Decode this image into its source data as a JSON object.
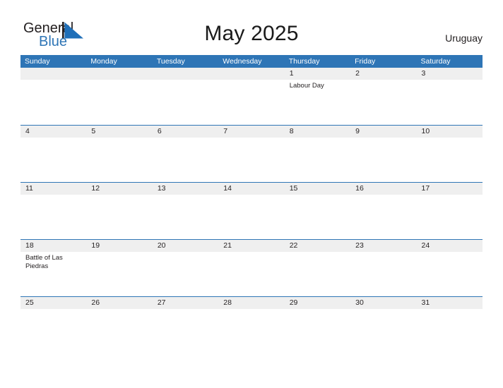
{
  "brand": {
    "word_one": "General",
    "word_two": "Blue",
    "mark_icon": "triangle-logo-icon",
    "accent_color": "#2e75b6",
    "text_color": "#231f20"
  },
  "header": {
    "title": "May 2025",
    "country": "Uruguay"
  },
  "calendar": {
    "header_bg": "#2e75b6",
    "band_bg": "#efefef",
    "row_border": "#2e75b6",
    "weekdays": [
      "Sunday",
      "Monday",
      "Tuesday",
      "Wednesday",
      "Thursday",
      "Friday",
      "Saturday"
    ],
    "weeks": [
      [
        {
          "day": "",
          "events": []
        },
        {
          "day": "",
          "events": []
        },
        {
          "day": "",
          "events": []
        },
        {
          "day": "",
          "events": []
        },
        {
          "day": "1",
          "events": [
            "Labour Day"
          ]
        },
        {
          "day": "2",
          "events": []
        },
        {
          "day": "3",
          "events": []
        }
      ],
      [
        {
          "day": "4",
          "events": []
        },
        {
          "day": "5",
          "events": []
        },
        {
          "day": "6",
          "events": []
        },
        {
          "day": "7",
          "events": []
        },
        {
          "day": "8",
          "events": []
        },
        {
          "day": "9",
          "events": []
        },
        {
          "day": "10",
          "events": []
        }
      ],
      [
        {
          "day": "11",
          "events": []
        },
        {
          "day": "12",
          "events": []
        },
        {
          "day": "13",
          "events": []
        },
        {
          "day": "14",
          "events": []
        },
        {
          "day": "15",
          "events": []
        },
        {
          "day": "16",
          "events": []
        },
        {
          "day": "17",
          "events": []
        }
      ],
      [
        {
          "day": "18",
          "events": [
            "Battle of Las Piedras"
          ]
        },
        {
          "day": "19",
          "events": []
        },
        {
          "day": "20",
          "events": []
        },
        {
          "day": "21",
          "events": []
        },
        {
          "day": "22",
          "events": []
        },
        {
          "day": "23",
          "events": []
        },
        {
          "day": "24",
          "events": []
        }
      ],
      [
        {
          "day": "25",
          "events": []
        },
        {
          "day": "26",
          "events": []
        },
        {
          "day": "27",
          "events": []
        },
        {
          "day": "28",
          "events": []
        },
        {
          "day": "29",
          "events": []
        },
        {
          "day": "30",
          "events": []
        },
        {
          "day": "31",
          "events": []
        }
      ]
    ]
  }
}
